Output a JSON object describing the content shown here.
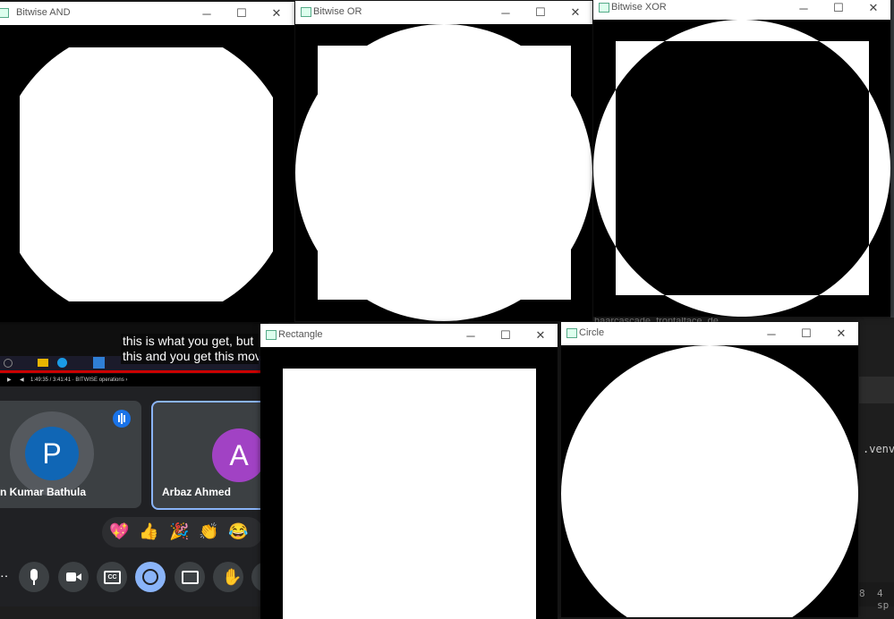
{
  "background": {
    "youtube": {
      "time": "1:49:35 / 3:41:41 · BITWISE operations ›"
    },
    "caption": {
      "line1": "this is what you get, but",
      "line2": "this and you get this mov"
    },
    "meet": {
      "participant1": {
        "initial": "P",
        "name": "n Kumar Bathula"
      },
      "participant2": {
        "initial": "A",
        "name": "Arbaz Ahmed"
      },
      "reactions": [
        "💖",
        "👍",
        "🎉",
        "👏",
        "😂"
      ],
      "controls": [
        "mic-icon",
        "camera-icon",
        "captions-icon",
        "emoji-icon",
        "present-icon",
        "raise-hand-icon"
      ]
    },
    "vscode": {
      "file_tab": "haarcascade_frontalface_de",
      "venv_text": ".venv\\",
      "status_8": "8",
      "status_spaces": "4 sp"
    }
  },
  "windows": [
    {
      "id": "and",
      "title": "Bitwise AND"
    },
    {
      "id": "or",
      "title": "Bitwise OR"
    },
    {
      "id": "xor",
      "title": "Bitwise XOR"
    },
    {
      "id": "rect",
      "title": "Rectangle"
    },
    {
      "id": "circle",
      "title": "Circle"
    }
  ],
  "titlebar_buttons": {
    "minimize": "─",
    "maximize": "☐",
    "close": "✕"
  }
}
